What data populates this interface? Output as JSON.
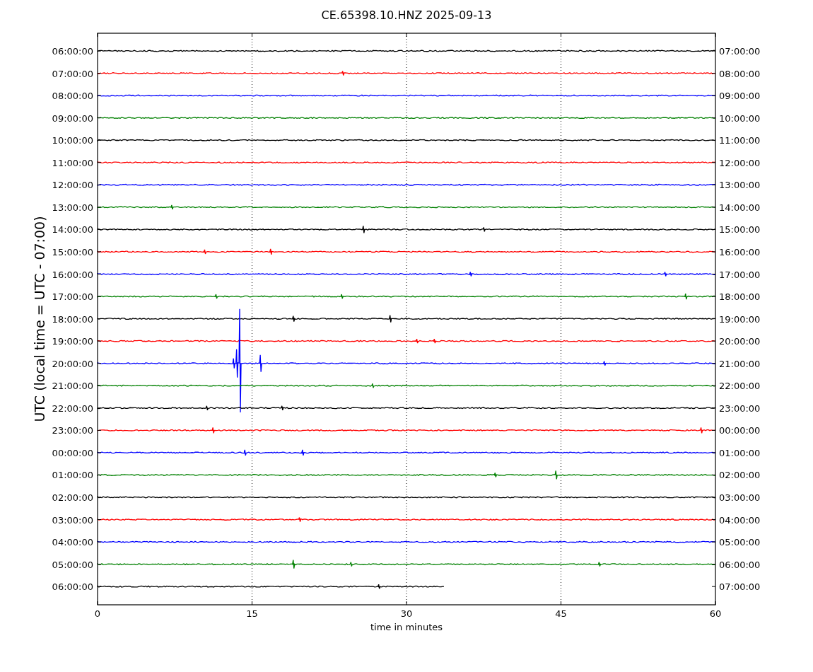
{
  "title": "CE.65398.10.HNZ 2025-09-13",
  "ylabel": "UTC (local time = UTC - 07:00)",
  "xlabel": "time in minutes",
  "xticks": [
    "0",
    "15",
    "30",
    "45",
    "60"
  ],
  "rows": [
    {
      "utc": "06:00:00",
      "local": "07:00:00",
      "color": "#000000",
      "complete": true
    },
    {
      "utc": "07:00:00",
      "local": "08:00:00",
      "color": "#ff0000",
      "complete": true
    },
    {
      "utc": "08:00:00",
      "local": "09:00:00",
      "color": "#0000ff",
      "complete": true
    },
    {
      "utc": "09:00:00",
      "local": "10:00:00",
      "color": "#008000",
      "complete": true
    },
    {
      "utc": "10:00:00",
      "local": "11:00:00",
      "color": "#000000",
      "complete": true
    },
    {
      "utc": "11:00:00",
      "local": "12:00:00",
      "color": "#ff0000",
      "complete": true
    },
    {
      "utc": "12:00:00",
      "local": "13:00:00",
      "color": "#0000ff",
      "complete": true
    },
    {
      "utc": "13:00:00",
      "local": "14:00:00",
      "color": "#008000",
      "complete": true
    },
    {
      "utc": "14:00:00",
      "local": "15:00:00",
      "color": "#000000",
      "complete": true
    },
    {
      "utc": "15:00:00",
      "local": "16:00:00",
      "color": "#ff0000",
      "complete": true
    },
    {
      "utc": "16:00:00",
      "local": "17:00:00",
      "color": "#0000ff",
      "complete": true
    },
    {
      "utc": "17:00:00",
      "local": "18:00:00",
      "color": "#008000",
      "complete": true
    },
    {
      "utc": "18:00:00",
      "local": "19:00:00",
      "color": "#000000",
      "complete": true
    },
    {
      "utc": "19:00:00",
      "local": "20:00:00",
      "color": "#ff0000",
      "complete": true
    },
    {
      "utc": "20:00:00",
      "local": "21:00:00",
      "color": "#0000ff",
      "complete": true
    },
    {
      "utc": "21:00:00",
      "local": "22:00:00",
      "color": "#008000",
      "complete": true
    },
    {
      "utc": "22:00:00",
      "local": "23:00:00",
      "color": "#000000",
      "complete": true
    },
    {
      "utc": "23:00:00",
      "local": "00:00:00",
      "color": "#ff0000",
      "complete": true
    },
    {
      "utc": "00:00:00",
      "local": "01:00:00",
      "color": "#0000ff",
      "complete": true
    },
    {
      "utc": "01:00:00",
      "local": "02:00:00",
      "color": "#008000",
      "complete": true
    },
    {
      "utc": "02:00:00",
      "local": "03:00:00",
      "color": "#000000",
      "complete": true
    },
    {
      "utc": "03:00:00",
      "local": "04:00:00",
      "color": "#ff0000",
      "complete": true
    },
    {
      "utc": "04:00:00",
      "local": "05:00:00",
      "color": "#0000ff",
      "complete": true
    },
    {
      "utc": "05:00:00",
      "local": "06:00:00",
      "color": "#008000",
      "complete": true
    },
    {
      "utc": "06:00:00",
      "local": "07:00:00",
      "color": "#000000",
      "complete": false
    }
  ]
}
